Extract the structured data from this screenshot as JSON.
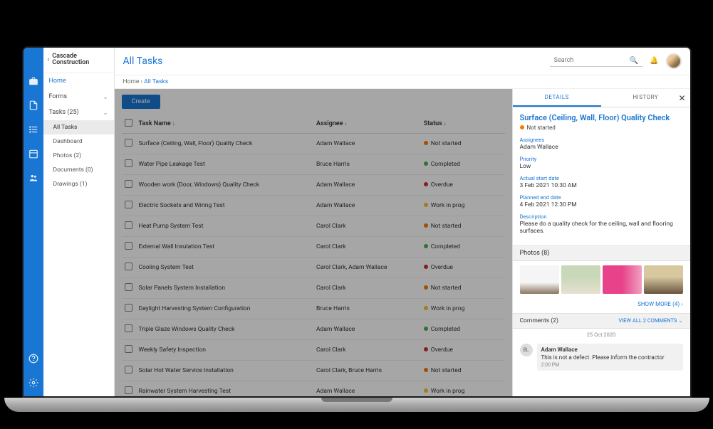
{
  "org_name": "Cascade Construction",
  "page_title": "All Tasks",
  "breadcrumb": {
    "home": "Home",
    "current": "All Tasks"
  },
  "search": {
    "placeholder": "Search"
  },
  "sidebar": {
    "home": "Home",
    "forms": "Forms",
    "tasks": "Tasks (25)",
    "subs": {
      "all_tasks": "All Tasks",
      "dashboard": "Dashboard",
      "photos": "Photos (2)",
      "documents": "Documents (0)",
      "drawings": "Drawings (1)"
    }
  },
  "create_label": "Create",
  "columns": {
    "name": "Task Name",
    "assignee": "Assignee",
    "status": "Status"
  },
  "tasks": [
    {
      "name": "Surface (Ceiling, Wall, Floor) Quality Check",
      "assignee": "Adam Wallace",
      "status": "Not started",
      "status_class": "dot-notstarted"
    },
    {
      "name": "Water Pipe Leakage Test",
      "assignee": "Bruce Harris",
      "status": "Completed",
      "status_class": "dot-completed"
    },
    {
      "name": "Wooden work (Door, Windows) Quality Check",
      "assignee": "Adam Wallace",
      "status": "Overdue",
      "status_class": "dot-overdue"
    },
    {
      "name": "Electric Sockets and Wiring Test",
      "assignee": "Adam Wallace",
      "status": "Work in prog",
      "status_class": "dot-progress"
    },
    {
      "name": "Heat Pump System Test",
      "assignee": "Carol Clark",
      "status": "Not started",
      "status_class": "dot-notstarted"
    },
    {
      "name": "External Wall Insulation Test",
      "assignee": "Carol Clark",
      "status": "Completed",
      "status_class": "dot-completed"
    },
    {
      "name": "Cooling System Test",
      "assignee": "Carol Clark, Adam Wallace",
      "status": "Overdue",
      "status_class": "dot-overdue"
    },
    {
      "name": "Solar Panels System Installation",
      "assignee": "Carol Clark",
      "status": "Not started",
      "status_class": "dot-notstarted"
    },
    {
      "name": "Daylight Harvesting System Configuration",
      "assignee": "Bruce Harris",
      "status": "Work in prog",
      "status_class": "dot-progress"
    },
    {
      "name": "Triple Glaze Windows Quality Check",
      "assignee": "Adam Wallace",
      "status": "Completed",
      "status_class": "dot-completed"
    },
    {
      "name": "Weekly Safety Inspection",
      "assignee": "Carol Clark",
      "status": "Overdue",
      "status_class": "dot-overdue"
    },
    {
      "name": "Solar Hot Water Service Installation",
      "assignee": "Carol Clark, Bruce Harris",
      "status": "Not started",
      "status_class": "dot-notstarted"
    },
    {
      "name": "Rainwater System Harvesting Test",
      "assignee": "Adam Wallace",
      "status": "Work in prog",
      "status_class": "dot-progress"
    }
  ],
  "detail": {
    "tabs": {
      "details": "DETAILS",
      "history": "HISTORY"
    },
    "title": "Surface (Ceiling, Wall, Floor) Quality Check",
    "status": "Not started",
    "fields": {
      "assignees_label": "Assignees",
      "assignees": "Adam Wallace",
      "priority_label": "Priority",
      "priority": "Low",
      "actual_start_label": "Actual start date",
      "actual_start": "3 Feb 2021 10:30 AM",
      "planned_end_label": "Planned end date",
      "planned_end": "4 Feb 2021 12:30 PM",
      "description_label": "Description",
      "description": "Please do a quality check for the ceiling, wall and flooring surfaces."
    },
    "photos_header": "Photos (8)",
    "show_more": "SHOW MORE (4)",
    "comments_header": "Comments (2)",
    "view_all": "VIEW ALL 2 COMMENTS ⌄",
    "comment_date": "25 Oct 2020",
    "comment": {
      "initials": "BL",
      "author": "Adam Wallace",
      "text": "This is not a defect. Please inform the contractor",
      "time": "2:00 PM"
    }
  }
}
